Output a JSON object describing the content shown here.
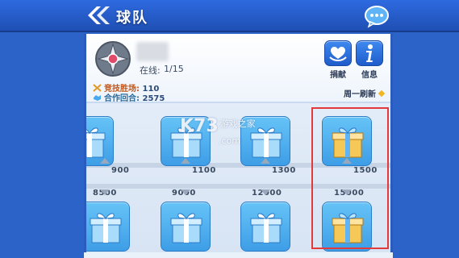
{
  "header": {
    "title": "球队"
  },
  "team": {
    "online_label": "在线:",
    "online_value": "1/15",
    "arena_wins_label": "竞技胜场:",
    "arena_wins_value": "110",
    "coop_rounds_label": "合作回合:",
    "coop_rounds_value": "2575",
    "refresh_note": "周一刷新"
  },
  "actions": {
    "donate_label": "捐献",
    "info_label": "信息"
  },
  "rewards": {
    "row1": [
      {
        "threshold": "900"
      },
      {
        "threshold": "1100"
      },
      {
        "threshold": "1300"
      },
      {
        "threshold": "1500"
      }
    ],
    "row2": [
      {
        "threshold": "8500"
      },
      {
        "threshold": "9000"
      },
      {
        "threshold": "12000"
      },
      {
        "threshold": "15000"
      }
    ]
  },
  "watermark": {
    "main": "K73",
    "sub": "游戏之家",
    "domain": ".com"
  },
  "colors": {
    "accent_blue": "#2c63c9",
    "gift_blue": "#4aa8ec",
    "highlight_red": "#e23a3a",
    "gold": "#f2b624"
  }
}
